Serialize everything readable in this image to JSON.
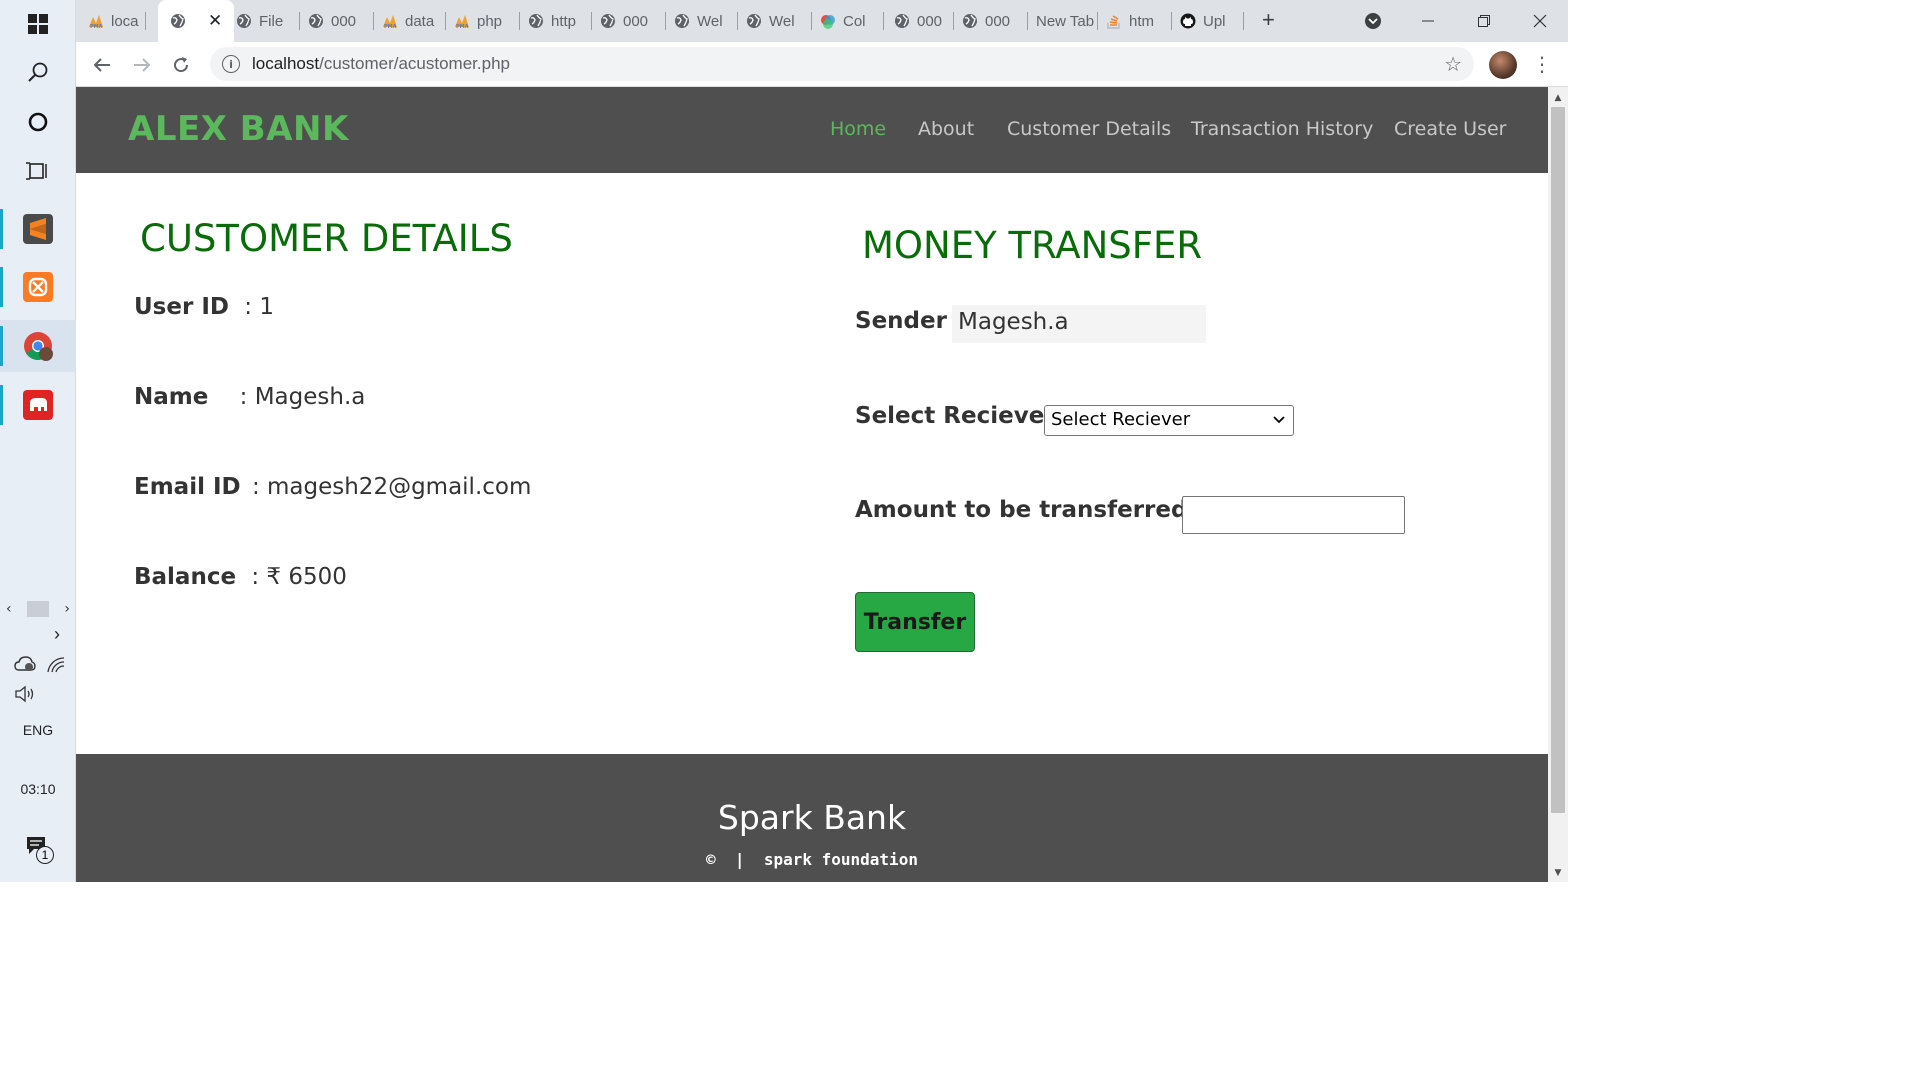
{
  "taskbar": {
    "start_icon": "windows-logo-icon",
    "search_icon": "search-icon",
    "cortana_icon": "cortana-circle-icon",
    "taskview_icon": "task-view-icon",
    "apps": [
      {
        "name": "sublime-text",
        "glyph": "S",
        "color": "#f58220"
      },
      {
        "name": "xampp",
        "glyph": "⊠",
        "color": "#fb7a24"
      },
      {
        "name": "chrome",
        "glyph": "",
        "color": "#4285f4"
      },
      {
        "name": "elephant-app",
        "glyph": "🐘",
        "color": "#e02424"
      }
    ],
    "tray": {
      "language": "ENG",
      "time": "03:10",
      "notification_count": "1"
    }
  },
  "browser": {
    "tabs": [
      {
        "label": "loca",
        "icon": "phpmyadmin-icon"
      },
      {
        "label": "",
        "icon": "globe-icon",
        "active": true
      },
      {
        "label": "File",
        "icon": "globe-icon"
      },
      {
        "label": "000",
        "icon": "globe-icon"
      },
      {
        "label": "data",
        "icon": "phpmyadmin-icon"
      },
      {
        "label": "php",
        "icon": "phpmyadmin-icon"
      },
      {
        "label": "http",
        "icon": "globe-icon"
      },
      {
        "label": "000",
        "icon": "globe-icon"
      },
      {
        "label": "Wel",
        "icon": "globe-icon"
      },
      {
        "label": "Wel",
        "icon": "globe-icon"
      },
      {
        "label": "Col",
        "icon": "colorful-icon"
      },
      {
        "label": "000",
        "icon": "globe-icon"
      },
      {
        "label": "000",
        "icon": "globe-icon"
      },
      {
        "label": "New Tab",
        "icon": ""
      },
      {
        "label": "htm",
        "icon": "stackoverflow-icon"
      },
      {
        "label": "Upl",
        "icon": "github-icon"
      }
    ],
    "new_tab_label": "+",
    "url_host": "localhost",
    "url_path": "/customer/acustomer.php"
  },
  "site": {
    "brand": "ALEX BANK",
    "nav": [
      "Home",
      "About",
      "Customer Details",
      "Transaction History",
      "Create User"
    ],
    "nav_active": "Home",
    "customer": {
      "title": "CUSTOMER DETAILS",
      "user_id_label": "User ID",
      "user_id_value": ": 1",
      "name_label": "Name",
      "name_value": ": Magesh.a",
      "email_label": "Email ID",
      "email_value": ": magesh22@gmail.com",
      "balance_label": "Balance",
      "balance_value": ": ₹ 6500"
    },
    "transfer": {
      "title": "MONEY TRANSFER",
      "sender_label": "Sender",
      "sender_sep": ":",
      "sender_value": "Magesh.a",
      "receiver_label": "Select Reciever:",
      "receiver_selected": "Select Reciever",
      "amount_label": "Amount to be transferred₹:",
      "amount_value": "",
      "button_label": "Transfer"
    },
    "footer": {
      "title": "Spark Bank",
      "copyright": "©  |  spark foundation"
    },
    "colors": {
      "nav_bg": "#4f4f4f",
      "brand_green": "#5cb85c",
      "title_green": "#0a6b0a",
      "button_green": "#28a745"
    }
  }
}
